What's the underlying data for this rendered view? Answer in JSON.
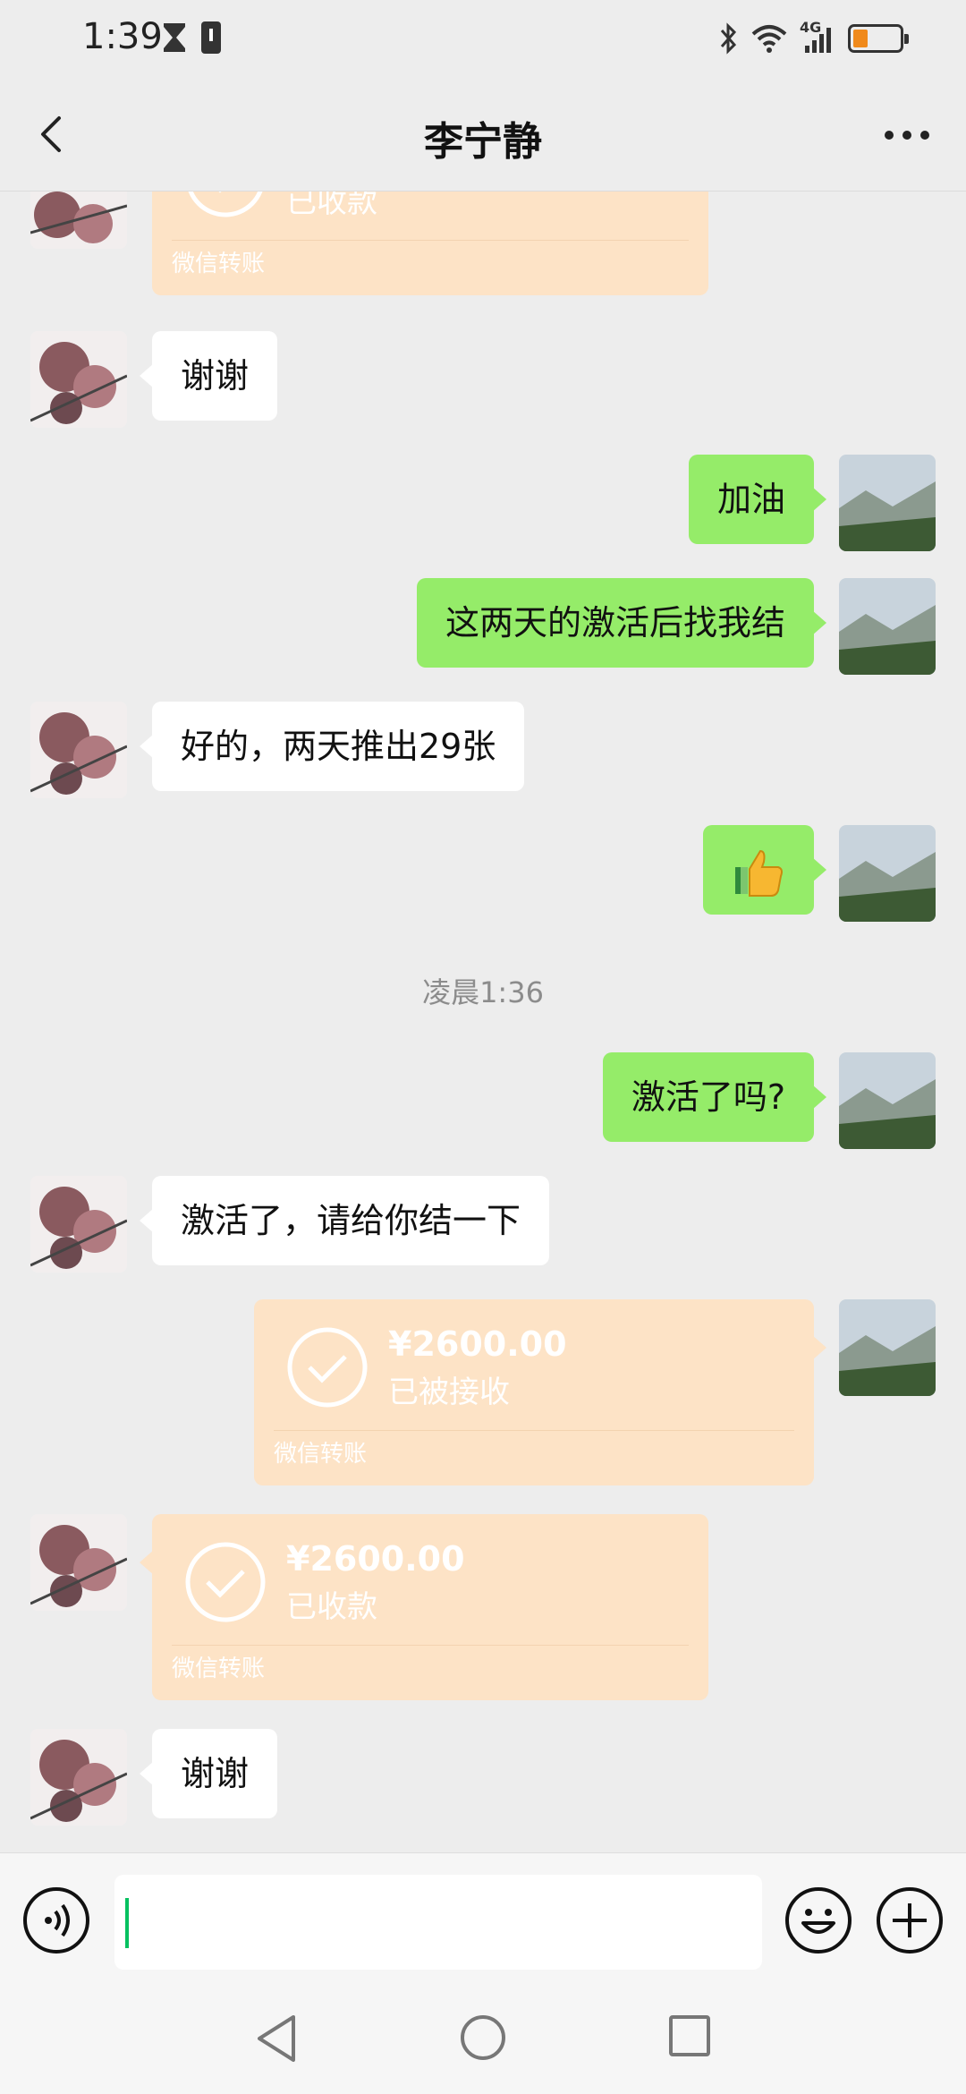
{
  "status_bar": {
    "time": "1:39",
    "network": "4G"
  },
  "header": {
    "title": "李宁静"
  },
  "messages": {
    "m0_transfer": {
      "status": "已收款",
      "footer": "微信转账"
    },
    "m1": "谢谢",
    "m2": "加油",
    "m3": "这两天的激活后找我结",
    "m4": "好的，两天推出29张",
    "m5_emoji": "thumbs-up-emoji",
    "timestamp": "凌晨1:36",
    "m6": "激活了吗?",
    "m7": "激活了，请给你结一下",
    "m8_transfer": {
      "amount": "¥2600.00",
      "status": "已被接收",
      "footer": "微信转账"
    },
    "m9_transfer": {
      "amount": "¥2600.00",
      "status": "已收款",
      "footer": "微信转账"
    },
    "m10": "谢谢"
  },
  "colors": {
    "outgoing_bubble": "#95ec69",
    "incoming_bubble": "#ffffff",
    "transfer_card": "#fde3c6",
    "chat_background": "#ededed",
    "caret": "#07c160"
  },
  "input_bar": {
    "value": ""
  },
  "icons": [
    "back-arrow-icon",
    "more-dots-icon",
    "voice-icon",
    "emoji-icon",
    "plus-icon",
    "nav-back-icon",
    "nav-home-icon",
    "nav-recent-icon"
  ]
}
